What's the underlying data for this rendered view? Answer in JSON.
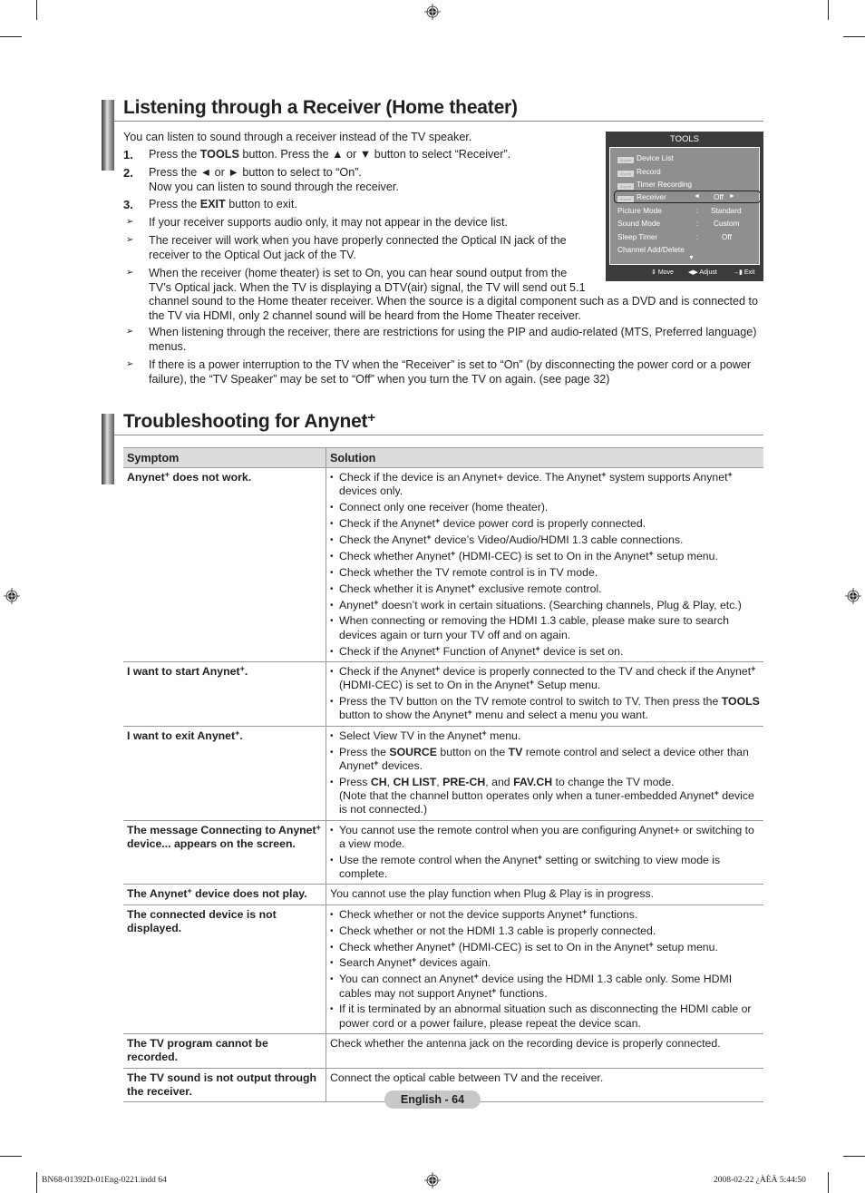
{
  "section1": {
    "title": "Listening through a Receiver (Home theater)",
    "intro": "You can listen to sound through a receiver instead of the TV speaker.",
    "steps": [
      {
        "num": "1.",
        "parts": [
          [
            "Press the ",
            false
          ],
          [
            "TOOLS",
            true
          ],
          [
            " button. Press the ▲ or ▼ button to select “Receiver”.",
            false
          ]
        ]
      },
      {
        "num": "2.",
        "parts": [
          [
            "Press the ◄ or ► button to select to “On”.",
            false
          ]
        ],
        "line2": "Now you can listen to sound through the receiver."
      },
      {
        "num": "3.",
        "parts": [
          [
            "Press the ",
            false
          ],
          [
            "EXIT",
            true
          ],
          [
            " button to exit.",
            false
          ]
        ]
      }
    ],
    "notes": [
      "If your receiver supports audio only, it may not appear in the device list.",
      "The receiver will work when you have properly connected the Optical IN jack of the receiver to the Optical Out jack of the TV.",
      "When the receiver (home theater) is set to On, you can hear sound output from the TV’s Optical jack. When the TV is displaying a DTV(air) signal, the TV will send out 5.1 channel sound to the Home theater receiver. When the source is a digital component such as a DVD and is connected to the TV via HDMI, only 2 channel sound will be heard from the Home Theater receiver.",
      "When listening through the receiver, there are restrictions for using the PIP and audio-related (MTS, Preferred language) menus.",
      "If there is a power interruption to the TV when the “Receiver” is set to “On” (by disconnecting the power cord or a power failure), the “TV Speaker” may be set to “Off” when you turn the TV on again. (see page 32)"
    ]
  },
  "tools_menu": {
    "title": "TOOLS",
    "logo_text": "Anynet",
    "anynet_items": [
      "Device List",
      "Record",
      "Timer Recording"
    ],
    "selected": {
      "label": "Receiver",
      "left_arrow": "◄",
      "value": "Off",
      "right_arrow": "►"
    },
    "settings": [
      {
        "label": "Picture Mode",
        "sep": ":",
        "value": "Standard"
      },
      {
        "label": "Sound Mode",
        "sep": ":",
        "value": "Custom"
      },
      {
        "label": "Sleep Timer",
        "sep": ":",
        "value": "Off"
      }
    ],
    "last_item": "Channel Add/Delete",
    "more_arrow": "▼",
    "footer": {
      "move": "Move",
      "adjust": "Adjust",
      "exit": "Exit"
    }
  },
  "section2": {
    "title": "Troubleshooting for Anynet",
    "title_sup": "+",
    "table": {
      "headers": [
        "Symptom",
        "Solution"
      ],
      "rows": [
        {
          "symptom": "Anynet⁺ does not work.",
          "solutions": [
            "Check if the device is an Anynet+ device. The Anynet⁺ system supports Anynet⁺ devices only.",
            "Connect only one receiver (home theater).",
            "Check if the Anynet⁺ device power cord is properly connected.",
            "Check the Anynet⁺ device’s Video/Audio/HDMI 1.3 cable connections.",
            "Check whether Anynet⁺ (HDMI-CEC) is set to On in the Anynet⁺ setup menu.",
            "Check whether the TV remote control is in TV mode.",
            "Check whether it is Anynet⁺ exclusive remote control.",
            "Anynet⁺ doesn’t work in certain situations. (Searching channels, Plug & Play, etc.)",
            "When connecting or removing the HDMI 1.3 cable, please make sure to search devices again or turn your TV off and on again.",
            "Check if the Anynet⁺ Function of Anynet⁺ device is set on."
          ]
        },
        {
          "symptom": "I want to start Anynet⁺.",
          "solutions": [
            "Check if the Anynet⁺ device is properly connected to the TV and check if the Anynet⁺ (HDMI-CEC) is set to On in the Anynet⁺ Setup menu.",
            "Press the TV button on the TV remote control to switch to TV. Then press the **TOOLS** button to show the Anynet⁺ menu and select a menu you want."
          ]
        },
        {
          "symptom": "I want to exit Anynet⁺.",
          "solutions": [
            "Select View TV in the Anynet⁺ menu.",
            "Press the **SOURCE** button on the **TV** remote control and select a device other than Anynet⁺ devices.",
            "Press **CH**, **CH LIST**, **PRE-CH**, and **FAV.CH** to change the TV mode.\n(Note that the channel button operates only when a tuner-embedded Anynet⁺ device is not connected.)"
          ]
        },
        {
          "symptom": "The message Connecting to Anynet⁺ device... appears on the screen.",
          "solutions": [
            "You cannot use the remote control when you are configuring Anynet+ or switching to a view mode.",
            "Use the remote control when the Anynet⁺ setting or switching to view mode is complete."
          ]
        },
        {
          "symptom": "The Anynet⁺ device does not play.",
          "plain": "You cannot use the play function when Plug & Play is in progress."
        },
        {
          "symptom": "The connected device is not displayed.",
          "solutions": [
            "Check whether or not the device supports Anynet⁺ functions.",
            "Check whether or not the HDMI 1.3 cable is properly connected.",
            "Check whether Anynet⁺ (HDMI-CEC) is set to On in the Anynet⁺ setup menu.",
            "Search Anynet⁺ devices again.",
            "You can connect an Anynet⁺ device using the HDMI 1.3 cable only. Some HDMI cables may not support Anynet⁺ functions.",
            "If it is terminated by an abnormal situation such as disconnecting the HDMI cable or power cord or a power failure, please repeat the device scan."
          ]
        },
        {
          "symptom": "The TV program cannot be recorded.",
          "plain": "Check whether the antenna jack on the recording device is properly connected."
        },
        {
          "symptom": "The TV sound is not output through the receiver.",
          "plain": "Connect the optical cable between TV and the receiver."
        }
      ]
    }
  },
  "footer": {
    "page_label": "English - 64",
    "slug_left": "BN68-01392D-01Eng-0221.indd   64",
    "slug_right": "2008-02-22   ¿ÀÈÄ 5:44:50"
  }
}
